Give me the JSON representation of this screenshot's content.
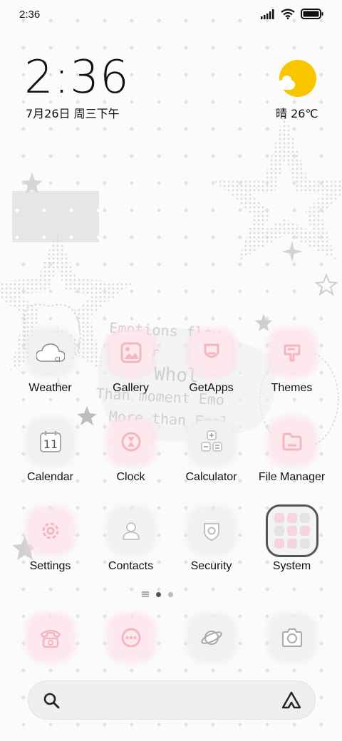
{
  "status_bar": {
    "time": "2:36",
    "icons": [
      "signal-icon",
      "wifi-icon",
      "battery-icon"
    ]
  },
  "clock_widget": {
    "time": "2:36",
    "date": "7月26日 周三下午"
  },
  "weather_widget": {
    "text": "晴 26℃",
    "icon": "sun-cloud-icon"
  },
  "apps": [
    {
      "label": "Weather",
      "icon": "weather-icon"
    },
    {
      "label": "Gallery",
      "icon": "gallery-icon"
    },
    {
      "label": "GetApps",
      "icon": "getapps-icon"
    },
    {
      "label": "Themes",
      "icon": "themes-icon"
    },
    {
      "label": "Calendar",
      "icon": "calendar-icon",
      "day": "11"
    },
    {
      "label": "Clock",
      "icon": "clock-icon"
    },
    {
      "label": "Calculator",
      "icon": "calculator-icon"
    },
    {
      "label": "File Manager",
      "icon": "file-manager-icon"
    },
    {
      "label": "Settings",
      "icon": "settings-icon"
    },
    {
      "label": "Contacts",
      "icon": "contacts-icon"
    },
    {
      "label": "Security",
      "icon": "security-icon"
    },
    {
      "label": "System",
      "icon": "folder-icon"
    }
  ],
  "dock": [
    {
      "icon": "phone-icon"
    },
    {
      "icon": "messages-icon"
    },
    {
      "icon": "browser-icon"
    },
    {
      "icon": "camera-icon"
    }
  ],
  "page_indicator": {
    "pages": 2,
    "active": 1
  },
  "wallpaper_text": [
    "Emotions flow",
    "sir",
    "Whol",
    "Than moment Emo",
    "More than Feel"
  ],
  "colors": {
    "accent_pink": "#fde8ed",
    "icon_pink": "#f4b6c5",
    "icon_gray": "#f1f1f1",
    "sun": "#f7c600"
  }
}
